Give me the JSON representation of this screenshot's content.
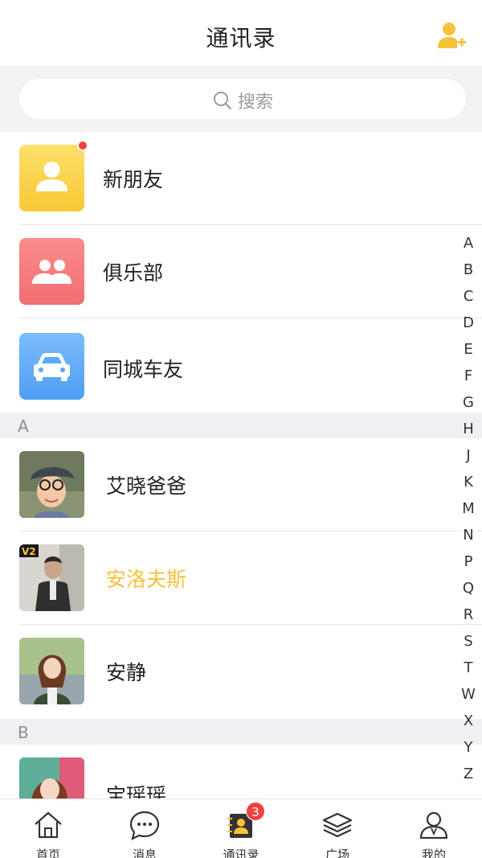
{
  "header": {
    "title": "通讯录",
    "add_icon": "add-user-icon",
    "accent_color": "#f5c23a"
  },
  "search": {
    "placeholder": "搜索",
    "icon": "search-icon"
  },
  "functions": [
    {
      "label": "新朋友",
      "icon": "person-icon",
      "color": "#fcd34d",
      "has_dot": true
    },
    {
      "label": "俱乐部",
      "icon": "group-icon",
      "color": "#f7777a"
    },
    {
      "label": "同城车友",
      "icon": "car-icon",
      "color": "#5aa9f7"
    }
  ],
  "sections": [
    {
      "letter": "A",
      "contacts": [
        {
          "name": "艾晓爸爸",
          "avatar": "boy-with-glasses-photo"
        },
        {
          "name": "安洛夫斯",
          "avatar": "man-in-vest-photo",
          "vip_badge": "V2",
          "highlight": true
        },
        {
          "name": "安静",
          "avatar": "girl-portrait-photo"
        }
      ]
    },
    {
      "letter": "B",
      "contacts": [
        {
          "name": "宝瑶瑶",
          "avatar": "woman-portrait-photo"
        }
      ]
    }
  ],
  "index_letters": [
    "A",
    "B",
    "C",
    "D",
    "E",
    "F",
    "G",
    "H",
    "J",
    "K",
    "M",
    "N",
    "P",
    "Q",
    "R",
    "S",
    "T",
    "W",
    "X",
    "Y",
    "Z"
  ],
  "tabbar": {
    "tabs": [
      {
        "label": "首页",
        "icon": "home-icon"
      },
      {
        "label": "消息",
        "icon": "chat-bubble-icon"
      },
      {
        "label": "通讯录",
        "icon": "contacts-book-icon",
        "badge": "3",
        "active": true
      },
      {
        "label": "广场",
        "icon": "layers-icon"
      },
      {
        "label": "我的",
        "icon": "profile-icon"
      }
    ]
  }
}
